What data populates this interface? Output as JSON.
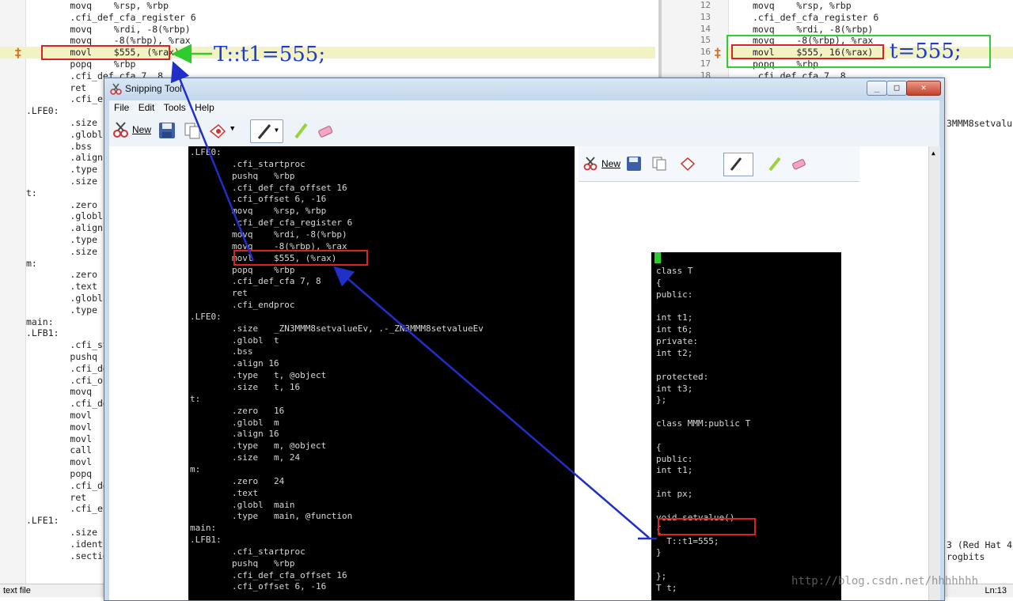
{
  "left_editor": {
    "lines": [
      {
        "text": "\tmovq\t%rsp, %rbp"
      },
      {
        "text": "\t.cfi_def_cfa_register 6"
      },
      {
        "text": "\tmovq\t%rdi, -8(%rbp)"
      },
      {
        "text": "\tmovq\t-8(%rbp), %rax"
      },
      {
        "text": "\tmovl\t$555, (%rax)"
      },
      {
        "text": "\tpopq\t%rbp"
      },
      {
        "text": "\t.cfi_def_cfa 7, 8"
      },
      {
        "text": "\tret"
      },
      {
        "text": "\t.cfi_endp"
      },
      {
        "text": ".LFE0:"
      },
      {
        "text": "\t.size"
      },
      {
        "text": "\t.globl"
      },
      {
        "text": "\t.bss"
      },
      {
        "text": "\t.align 16"
      },
      {
        "text": "\t.type"
      },
      {
        "text": "\t.size"
      },
      {
        "text": "t:"
      },
      {
        "text": "\t.zero"
      },
      {
        "text": "\t.globl"
      },
      {
        "text": "\t.align 16"
      },
      {
        "text": "\t.type"
      },
      {
        "text": "\t.size"
      },
      {
        "text": "m:"
      },
      {
        "text": "\t.zero"
      },
      {
        "text": "\t.text"
      },
      {
        "text": "\t.globl"
      },
      {
        "text": "\t.type"
      },
      {
        "text": "main:"
      },
      {
        "text": ".LFB1:"
      },
      {
        "text": "\t.cfi_star"
      },
      {
        "text": "\tpushq"
      },
      {
        "text": "\t.cfi_def_"
      },
      {
        "text": "\t.cfi_offs"
      },
      {
        "text": "\tmovq"
      },
      {
        "text": "\t.cfi_def_"
      },
      {
        "text": "\tmovl"
      },
      {
        "text": "\tmovl"
      },
      {
        "text": "\tmovl"
      },
      {
        "text": "\tcall"
      },
      {
        "text": "\tmovl"
      },
      {
        "text": "\tpopq"
      },
      {
        "text": "\t.cfi_def_"
      },
      {
        "text": "\tret"
      },
      {
        "text": "\t.cfi_endp"
      },
      {
        "text": ".LFE1:"
      },
      {
        "text": "\t.size"
      },
      {
        "text": "\t.ident"
      },
      {
        "text": "\t.section"
      }
    ]
  },
  "right_editor": {
    "lines": [
      {
        "num": "12",
        "text": "movq    %rsp, %rbp"
      },
      {
        "num": "13",
        "text": ".cfi_def_cfa_register 6"
      },
      {
        "num": "14",
        "text": "movq    %rdi, -8(%rbp)"
      },
      {
        "num": "15",
        "text": "movq    -8(%rbp), %rax"
      },
      {
        "num": "16",
        "text": "movl    $555, 16(%rax)"
      },
      {
        "num": "17",
        "text": "popq    %rbp"
      },
      {
        "num": "18",
        "text": ".cfi_def_cfa 7, 8"
      }
    ],
    "fragments": [
      "3MMM8setvalu",
      "3 (Red Hat 4",
      "rogbits"
    ]
  },
  "annotations": {
    "left": "T::t1=555;",
    "right": "t=555;"
  },
  "snipping_tool": {
    "title": "Snipping Tool",
    "menu": [
      "File",
      "Edit",
      "Tools",
      "Help"
    ],
    "new_label": "New",
    "terminal_lines": [
      ".LFE0:",
      "        .cfi_startproc",
      "        pushq   %rbp",
      "        .cfi_def_cfa_offset 16",
      "        .cfi_offset 6, -16",
      "        movq    %rsp, %rbp",
      "        .cfi_def_cfa_register 6",
      "        movq    %rdi, -8(%rbp)",
      "        movq    -8(%rbp), %rax",
      "        movl    $555, (%rax)",
      "        popq    %rbp",
      "        .cfi_def_cfa 7, 8",
      "        ret",
      "        .cfi_endproc",
      ".LFE0:",
      "        .size   _ZN3MMM8setvalueEv, .-_ZN3MMM8setvalueEv",
      "        .globl  t",
      "        .bss",
      "        .align 16",
      "        .type   t, @object",
      "        .size   t, 16",
      "t:",
      "        .zero   16",
      "        .globl  m",
      "        .align 16",
      "        .type   m, @object",
      "        .size   m, 24",
      "m:",
      "        .zero   24",
      "        .text",
      "        .globl  main",
      "        .type   main, @function",
      "main:",
      ".LFB1:",
      "        .cfi_startproc",
      "        pushq   %rbp",
      "        .cfi_def_cfa_offset 16",
      "        .cfi_offset 6, -16"
    ],
    "nested_new_label": "New",
    "source_lines": [
      "class T",
      "{",
      "public:",
      "",
      "int t1;",
      "int t6;",
      "private:",
      "int t2;",
      "",
      "protected:",
      "int t3;",
      "};",
      "",
      "class MMM:public T",
      "",
      "{",
      "public:",
      "int t1;",
      "",
      "int px;",
      "",
      "void setvalue()",
      "{",
      "  T::t1=555;",
      "}",
      "",
      "};",
      "T t;"
    ]
  },
  "statusbar": {
    "left": "text file",
    "right": "Ln:13"
  },
  "watermark": "http://blog.csdn.net/hhhhhhh"
}
